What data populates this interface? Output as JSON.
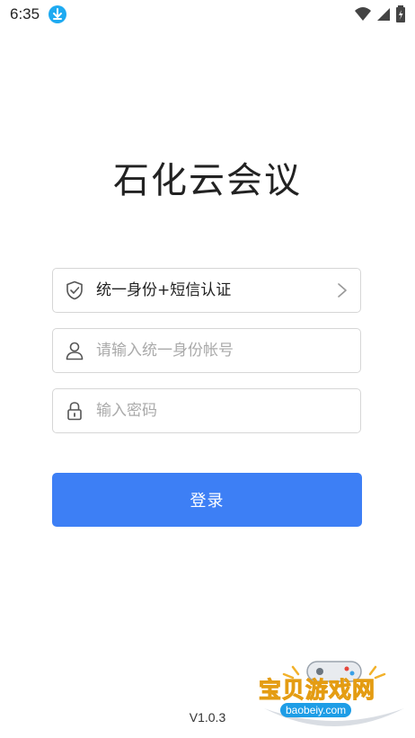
{
  "status_bar": {
    "time": "6:35",
    "icons": [
      "download-notification-icon",
      "wifi-icon",
      "cell-signal-icon",
      "battery-charging-icon"
    ]
  },
  "app": {
    "title": "石化云会议",
    "version": "V1.0.3"
  },
  "login_form": {
    "auth_method": {
      "value": "统一身份+短信认证",
      "icon": "shield-check-icon",
      "trailing_icon": "chevron-right-icon"
    },
    "username": {
      "placeholder": "请输入统一身份帐号",
      "value": "",
      "icon": "user-icon"
    },
    "password": {
      "placeholder": "输入密码",
      "value": "",
      "icon": "lock-icon"
    },
    "submit_label": "登录"
  },
  "watermark": {
    "text": "宝贝游戏网",
    "url": "baobeiy.com"
  },
  "colors": {
    "primary": "#3d7ff5",
    "border": "#d6d6d6",
    "placeholder": "#aaaaaa",
    "status_download": "#1eaaf1"
  }
}
